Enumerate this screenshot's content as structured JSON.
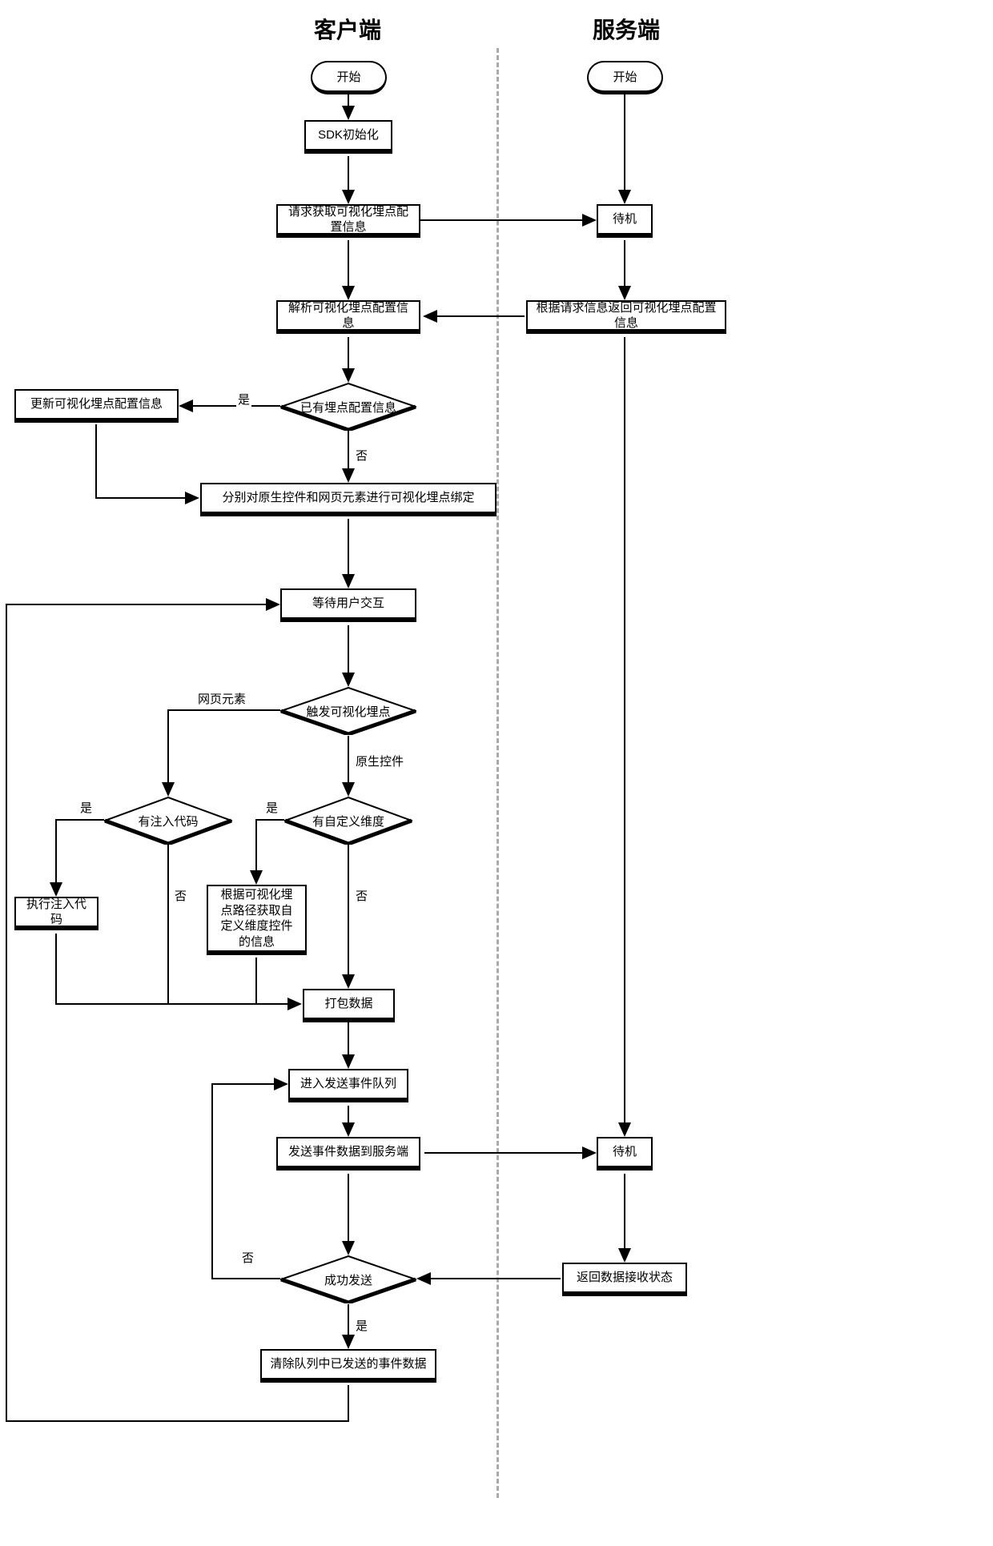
{
  "titles": {
    "client": "客户端",
    "server": "服务端"
  },
  "client": {
    "start": "开始",
    "sdk_init": "SDK初始化",
    "request_config": "请求获取可视化埋点配置信息",
    "parse_config": "解析可视化埋点配置信息",
    "has_config": "已有埋点配置信息",
    "update_config": "更新可视化埋点配置信息",
    "bind": "分别对原生控件和网页元素进行可视化埋点绑定",
    "wait_interaction": "等待用户交互",
    "trigger": "触发可视化埋点",
    "has_inject": "有注入代码",
    "exec_inject": "执行注入代码",
    "has_custom_dim": "有自定义维度",
    "get_custom_dim": "根据可视化埋点路径获取自定义维度控件的信息",
    "pack_data": "打包数据",
    "enter_queue": "进入发送事件队列",
    "send_data": "发送事件数据到服务端",
    "success_send": "成功发送",
    "clear_queue": "清除队列中已发送的事件数据"
  },
  "server": {
    "start": "开始",
    "standby1": "待机",
    "return_config": "根据请求信息返回可视化埋点配置信息",
    "standby2": "待机",
    "return_status": "返回数据接收状态"
  },
  "labels": {
    "yes": "是",
    "no": "否",
    "web_element": "网页元素",
    "native_control": "原生控件"
  }
}
